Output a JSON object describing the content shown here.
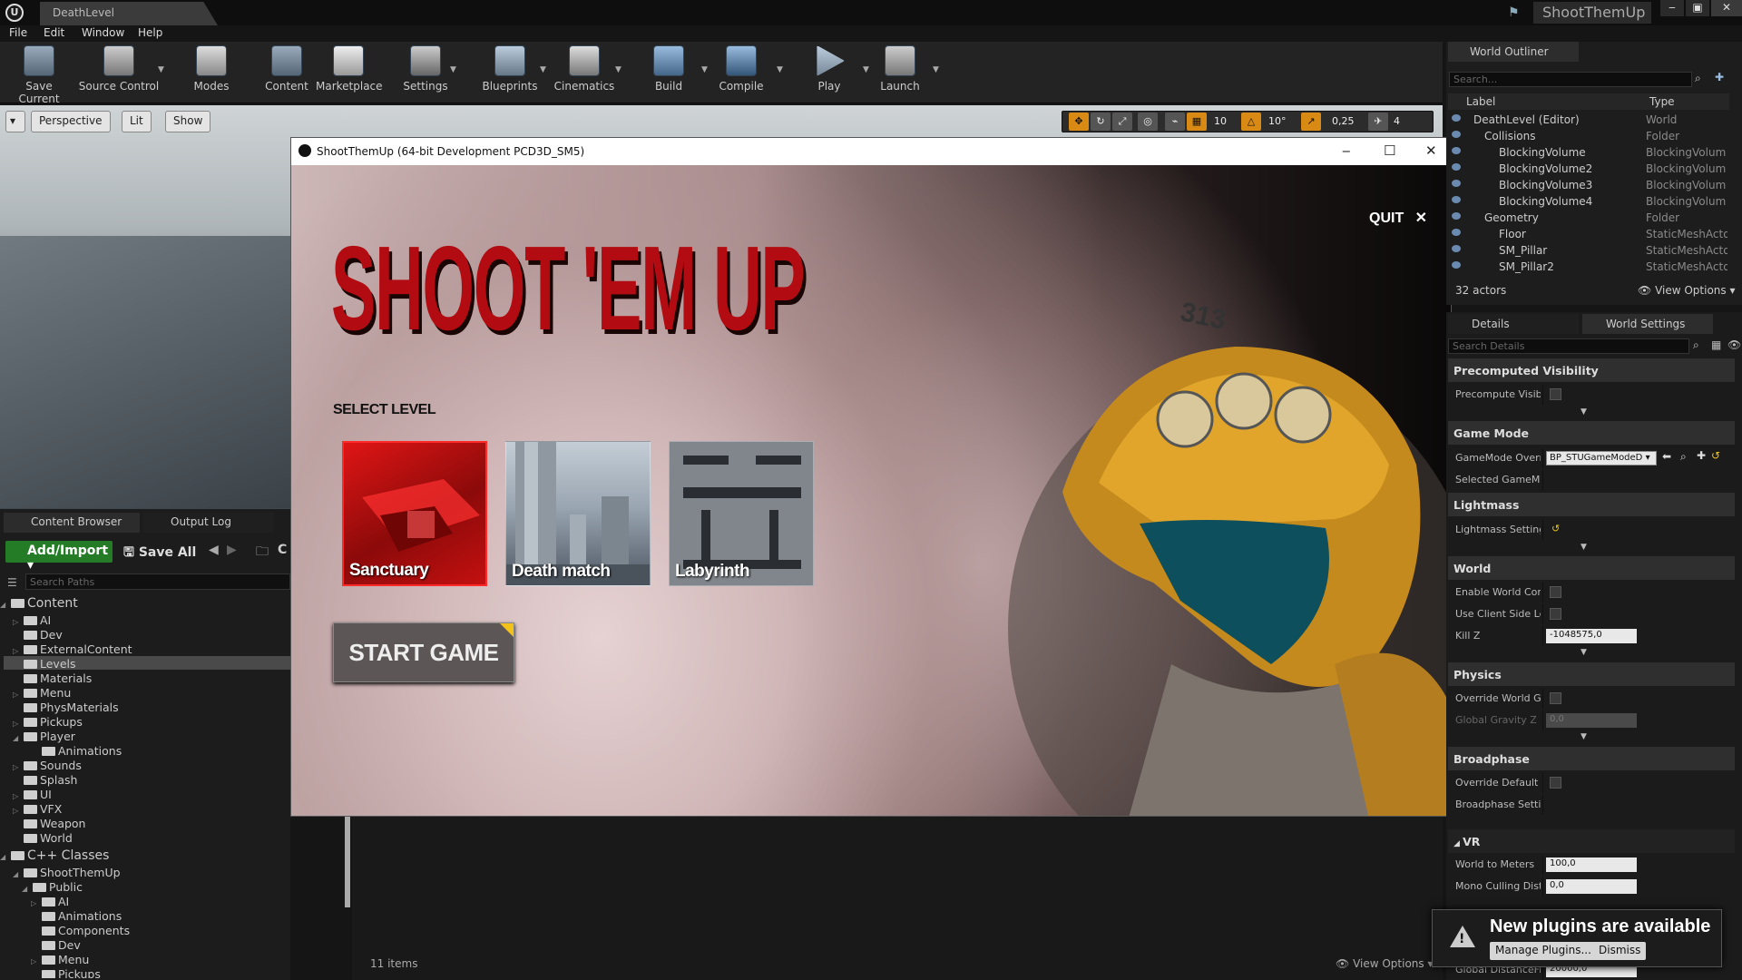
{
  "window": {
    "level_tab": "DeathLevel",
    "project_name": "ShootThemUp",
    "min": "‒",
    "max": "▣",
    "close": "✕"
  },
  "menu": [
    "File",
    "Edit",
    "Window",
    "Help"
  ],
  "toolbar": [
    {
      "label": "Save Current",
      "icon": "save-icon"
    },
    {
      "label": "Source Control",
      "icon": "source-control-icon"
    },
    {
      "label": "Modes",
      "icon": "modes-icon"
    },
    {
      "label": "Content",
      "icon": "content-icon"
    },
    {
      "label": "Marketplace",
      "icon": "marketplace-icon"
    },
    {
      "label": "Settings",
      "icon": "settings-icon"
    },
    {
      "label": "Blueprints",
      "icon": "blueprints-icon"
    },
    {
      "label": "Cinematics",
      "icon": "cinematics-icon"
    },
    {
      "label": "Build",
      "icon": "build-icon"
    },
    {
      "label": "Compile",
      "icon": "compile-icon"
    },
    {
      "label": "Play",
      "icon": "play-icon"
    },
    {
      "label": "Launch",
      "icon": "launch-icon"
    }
  ],
  "viewport": {
    "menu_arrow": "▾",
    "perspective": "Perspective",
    "lit": "Lit",
    "show": "Show",
    "grid_snap": "10",
    "rot_snap": "10°",
    "scale_snap": "0,25",
    "cam_speed": "4"
  },
  "game": {
    "window_title": "ShootThemUp (64-bit Development PCD3D_SM5)",
    "title": "SHOOT 'EM UP",
    "quit": "QUIT",
    "quit_icon": "✕",
    "select_level": "SELECT LEVEL",
    "levels": [
      "Sanctuary",
      "Death match",
      "Labyrinth"
    ],
    "start": "START GAME",
    "soldier_badge": "313"
  },
  "content_browser": {
    "tabs": [
      "Content Browser",
      "Output Log"
    ],
    "add_import": "Add/Import",
    "save_all": "Save All",
    "path_crumb": "C",
    "search_paths": "Search Paths",
    "root": "Content",
    "folders": [
      "AI",
      "Dev",
      "ExternalContent",
      "Levels",
      "Materials",
      "Menu",
      "PhysMaterials",
      "Pickups",
      "Player",
      "Animations",
      "Sounds",
      "Splash",
      "UI",
      "VFX",
      "Weapon",
      "World"
    ],
    "cpp_root": "C++ Classes",
    "cpp_items": [
      "ShootThemUp",
      "Public",
      "AI",
      "Animations",
      "Components",
      "Dev",
      "Menu",
      "Pickups"
    ],
    "items_count": "11 items",
    "view_options": "View Options"
  },
  "outliner": {
    "tab": "World Outliner",
    "search": "Search...",
    "col_label": "Label",
    "col_type": "Type",
    "rows": [
      {
        "label": "DeathLevel (Editor)",
        "type": "World"
      },
      {
        "label": "Collisions",
        "type": "Folder"
      },
      {
        "label": "BlockingVolume",
        "type": "BlockingVolum"
      },
      {
        "label": "BlockingVolume2",
        "type": "BlockingVolum"
      },
      {
        "label": "BlockingVolume3",
        "type": "BlockingVolum"
      },
      {
        "label": "BlockingVolume4",
        "type": "BlockingVolum"
      },
      {
        "label": "Geometry",
        "type": "Folder"
      },
      {
        "label": "Floor",
        "type": "StaticMeshActo"
      },
      {
        "label": "SM_Pillar",
        "type": "StaticMeshActo"
      },
      {
        "label": "SM_Pillar2",
        "type": "StaticMeshActo"
      }
    ],
    "count": "32 actors",
    "view_options": "View Options"
  },
  "details": {
    "tabs": [
      "Details",
      "World Settings"
    ],
    "search": "Search Details",
    "sections": {
      "precomputed": "Precomputed Visibility",
      "game_mode": "Game Mode",
      "lightmass": "Lightmass",
      "world": "World",
      "physics": "Physics",
      "broadphase": "Broadphase",
      "vr": "VR"
    },
    "props": {
      "precompute_vis": "Precompute Visibi",
      "gamemode_override": "GameMode Overri",
      "gamemode_value": "BP_STUGameModeD",
      "selected_gamemode": "Selected GameMc",
      "lightmass_settings": "Lightmass Setting",
      "enable_world_comp": "Enable World Comp",
      "use_client_side": "Use Client Side Lev",
      "kill_z": "Kill Z",
      "kill_z_value": "-1048575,0",
      "override_world_grav": "Override World Gra",
      "global_gravity_z": "Global Gravity Z",
      "global_gravity_value": "0,0",
      "override_default_b": "Override Default B",
      "broadphase_settings": "Broadphase Settin",
      "world_to_meters": "World to Meters",
      "world_to_meters_value": "100,0",
      "mono_culling": "Mono Culling Dista",
      "mono_culling_value": "0,0",
      "global_distance": "Global DistanceFie",
      "global_distance_value": "20000,0"
    }
  },
  "toast": {
    "title": "New plugins are available",
    "manage": "Manage Plugins...",
    "dismiss": "Dismiss"
  }
}
